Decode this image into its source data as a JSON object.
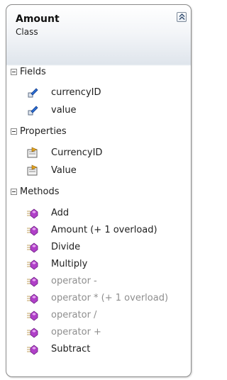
{
  "class": {
    "name": "Amount",
    "kind": "Class"
  },
  "sections": {
    "fields": {
      "label": "Fields",
      "items": [
        "currencyID",
        "value"
      ]
    },
    "properties": {
      "label": "Properties",
      "items": [
        "CurrencyID",
        "Value"
      ]
    },
    "methods": {
      "label": "Methods",
      "items": [
        {
          "label": "Add",
          "dimmed": false
        },
        {
          "label": "Amount (+ 1 overload)",
          "dimmed": false
        },
        {
          "label": "Divide",
          "dimmed": false
        },
        {
          "label": "Multiply",
          "dimmed": false
        },
        {
          "label": "operator -",
          "dimmed": true
        },
        {
          "label": "operator * (+ 1 overload)",
          "dimmed": true
        },
        {
          "label": "operator /",
          "dimmed": true
        },
        {
          "label": "operator +",
          "dimmed": true
        },
        {
          "label": "Subtract",
          "dimmed": false
        }
      ]
    }
  },
  "colors": {
    "border": "#8a8a8a",
    "method_icon": "#b040c8",
    "field_icon": "#2a6fd6",
    "dimmed_text": "#8e8e8e"
  },
  "icons": {
    "collapse": "double-chevron-up-icon",
    "field": "field-icon",
    "property": "property-icon",
    "method": "method-icon"
  }
}
